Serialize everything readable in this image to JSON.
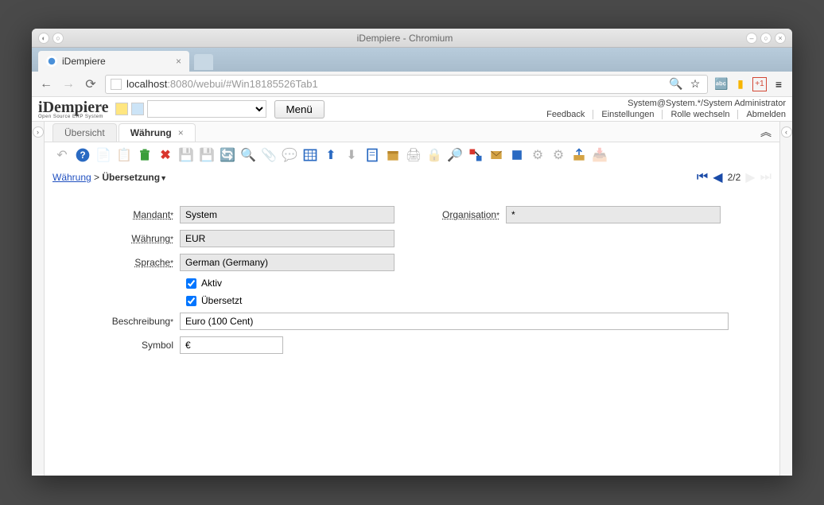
{
  "window_title": "iDempiere - Chromium",
  "browser_tab": {
    "title": "iDempiere"
  },
  "url": {
    "host": "localhost",
    "path": ":8080/webui/#Win18185526Tab1"
  },
  "logo": {
    "name": "iDempiere",
    "tagline": "Open Source ERP System"
  },
  "menu_button": "Menü",
  "user_context": "System@System.*/System Administrator",
  "header_links": {
    "feedback": "Feedback",
    "settings": "Einstellungen",
    "change_role": "Rolle wechseln",
    "logout": "Abmelden"
  },
  "tabs": {
    "overview": "Übersicht",
    "currency": "Währung"
  },
  "breadcrumb": {
    "parent": "Währung",
    "sep": " > ",
    "current": "Übersetzung"
  },
  "record_nav": {
    "position": "2/2"
  },
  "form": {
    "labels": {
      "client": "Mandant",
      "org": "Organisation",
      "currency": "Währung",
      "language": "Sprache",
      "active": "Aktiv",
      "translated": "Übersetzt",
      "description": "Beschreibung",
      "symbol": "Symbol"
    },
    "values": {
      "client": "System",
      "org": "*",
      "currency": "EUR",
      "language": "German (Germany)",
      "active": true,
      "translated": true,
      "description": "Euro (100 Cent)",
      "symbol": "€"
    }
  },
  "icons": {
    "star": "☆",
    "zoom": "🔍",
    "menu": "≡",
    "translate": "🈳",
    "gplus": "+1"
  }
}
